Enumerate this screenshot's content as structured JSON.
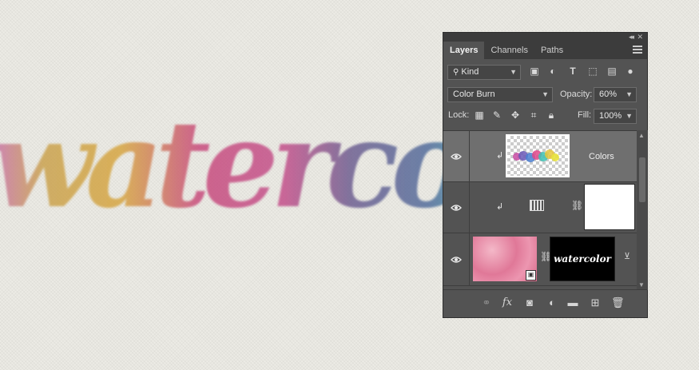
{
  "canvas": {
    "artwork_text": "watercolor"
  },
  "panel": {
    "tabs": [
      {
        "label": "Layers",
        "active": true
      },
      {
        "label": "Channels",
        "active": false
      },
      {
        "label": "Paths",
        "active": false
      }
    ],
    "filter": {
      "kind_label": "Kind"
    },
    "blend_mode": "Color Burn",
    "opacity_label": "Opacity:",
    "opacity_value": "60%",
    "lock_label": "Lock:",
    "fill_label": "Fill:",
    "fill_value": "100%",
    "layers": [
      {
        "name": "Colors",
        "selected": true,
        "clipped": true
      },
      {
        "name": "",
        "selected": false,
        "clipped": true,
        "type": "adjustment"
      },
      {
        "name": "",
        "selected": false,
        "type": "smart-object-with-mask",
        "mask_text": "watercolor"
      }
    ],
    "icons": {
      "filter_kind": "search-icon",
      "footer": [
        "link-icon",
        "fx-icon",
        "mask-icon",
        "adjustment-icon",
        "folder-icon",
        "new-layer-icon",
        "trash-icon"
      ]
    }
  },
  "colors": {
    "panel_bg": "#535353",
    "selected_layer": "#6f6f6f",
    "canvas_bg": "#ecebe5",
    "thumbnail_pink": "#e889a6"
  }
}
